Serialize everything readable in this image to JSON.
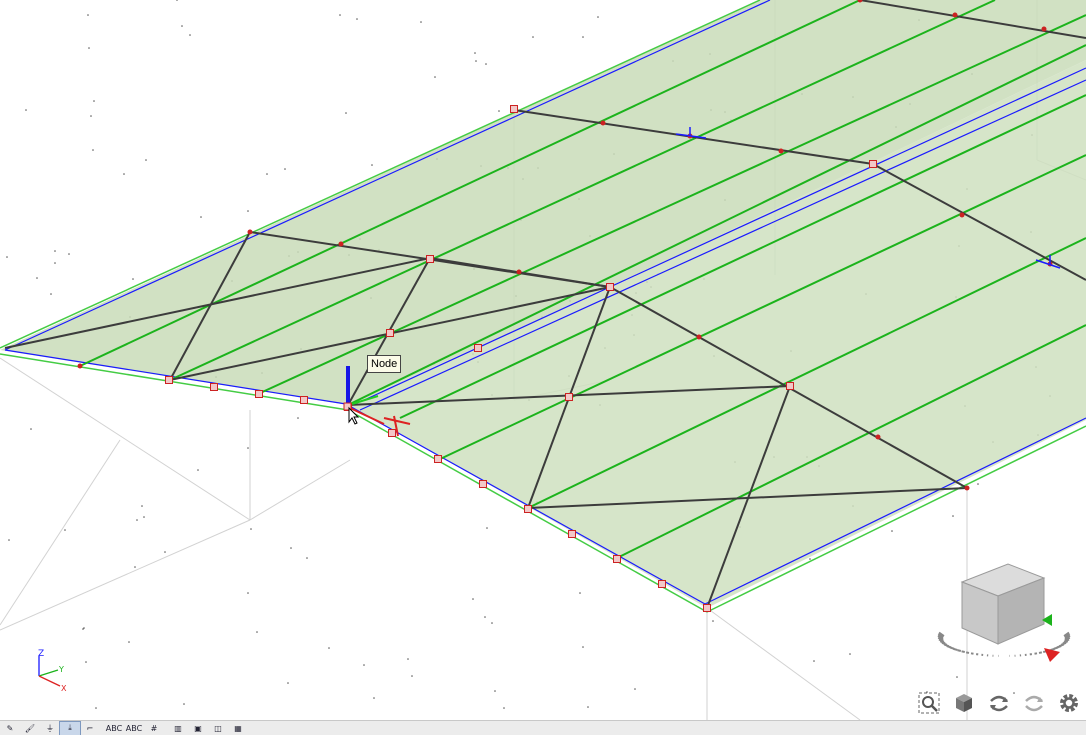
{
  "viewport": {
    "tooltip": "Node",
    "colors": {
      "background": "#ffffff",
      "surface_fill": "#c9dcb9",
      "edge_blue": "#1a1aff",
      "member_green": "#1cb31c",
      "truss_line": "#3c3c3c",
      "node_red": "#cc2222",
      "grid": "#cccccc"
    }
  },
  "axis_triad": {
    "z": "Z",
    "y": "Y",
    "x": "X"
  },
  "view_cube": {
    "icon": "view-cube-icon"
  },
  "nav_buttons": [
    {
      "name": "zoom-icon"
    },
    {
      "name": "view-cube-toggle-icon"
    },
    {
      "name": "rotate-view-icon"
    },
    {
      "name": "rotate-view-alt-icon"
    },
    {
      "name": "settings-gear-icon"
    }
  ],
  "bottom_toolbar": {
    "buttons": [
      {
        "name": "pencil-icon",
        "label": "✎"
      },
      {
        "name": "paint-icon",
        "label": "🖌"
      },
      {
        "name": "support-icon",
        "label": "⏚"
      },
      {
        "name": "load-icon",
        "label": "⤓"
      },
      {
        "name": "member-icon",
        "label": "⌐"
      },
      {
        "name": "abc-node-labels",
        "label": "ABC"
      },
      {
        "name": "abc-member-labels",
        "label": "ABC"
      },
      {
        "name": "grid-icon",
        "label": "#"
      },
      {
        "name": "table-icon",
        "label": "▥"
      },
      {
        "name": "window-icon",
        "label": "▣"
      },
      {
        "name": "multi-window-icon",
        "label": "◫"
      },
      {
        "name": "red-grid-icon",
        "label": "▦"
      }
    ]
  }
}
